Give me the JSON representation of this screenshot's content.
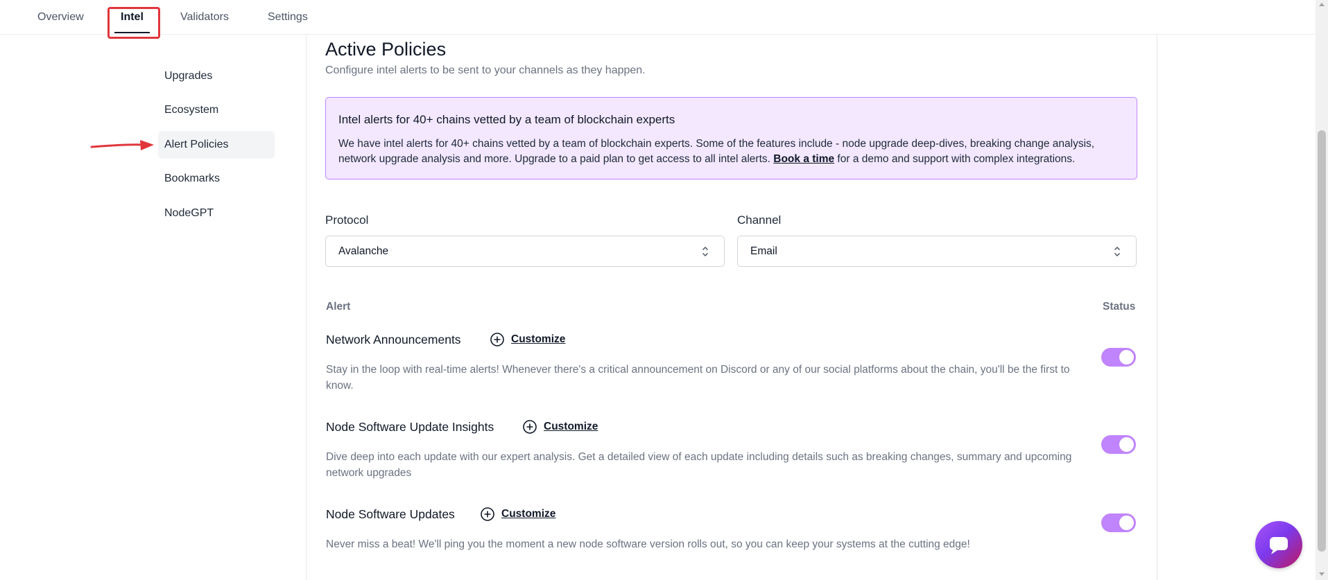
{
  "tabs": [
    {
      "label": "Overview"
    },
    {
      "label": "Intel"
    },
    {
      "label": "Validators"
    },
    {
      "label": "Settings"
    }
  ],
  "sidebar": {
    "items": [
      {
        "label": "Upgrades"
      },
      {
        "label": "Ecosystem"
      },
      {
        "label": "Alert Policies"
      },
      {
        "label": "Bookmarks"
      },
      {
        "label": "NodeGPT"
      }
    ]
  },
  "page": {
    "title": "Active Policies",
    "subtitle": "Configure intel alerts to be sent to your channels as they happen."
  },
  "banner": {
    "title": "Intel alerts for 40+ chains vetted by a team of blockchain experts",
    "body_before": "We have intel alerts for 40+ chains vetted by a team of blockchain experts. Some of the features include - node upgrade deep-dives, breaking change analysis, network upgrade analysis and more. Upgrade to a paid plan to get access to all intel alerts. ",
    "link": "Book a time",
    "body_after": " for a demo and support with complex integrations."
  },
  "filters": {
    "protocol_label": "Protocol",
    "protocol_value": "Avalanche",
    "channel_label": "Channel",
    "channel_value": "Email"
  },
  "table": {
    "alert_header": "Alert",
    "status_header": "Status",
    "customize_label": "Customize",
    "rows": [
      {
        "title": "Network Announcements",
        "description": "Stay in the loop with real-time alerts! Whenever there's a critical announcement on Discord or any of our social platforms about the chain, you'll be the first to know.",
        "enabled": true
      },
      {
        "title": "Node Software Update Insights",
        "description": "Dive deep into each update with our expert analysis. Get a detailed view of each update including details such as breaking changes, summary and upcoming network upgrades",
        "enabled": true
      },
      {
        "title": "Node Software Updates",
        "description": "Never miss a beat! We'll ping you the moment a new node software version rolls out, so you can keep your systems at the cutting edge!",
        "enabled": true
      }
    ]
  },
  "colors": {
    "toggle_on": "#c084fc",
    "banner_bg": "#f3e8ff",
    "annotation": "#e0363b"
  },
  "icons": [
    "plus-circle-icon",
    "chevron-up-down-icon",
    "chat-icon",
    "arrow-annotation"
  ]
}
